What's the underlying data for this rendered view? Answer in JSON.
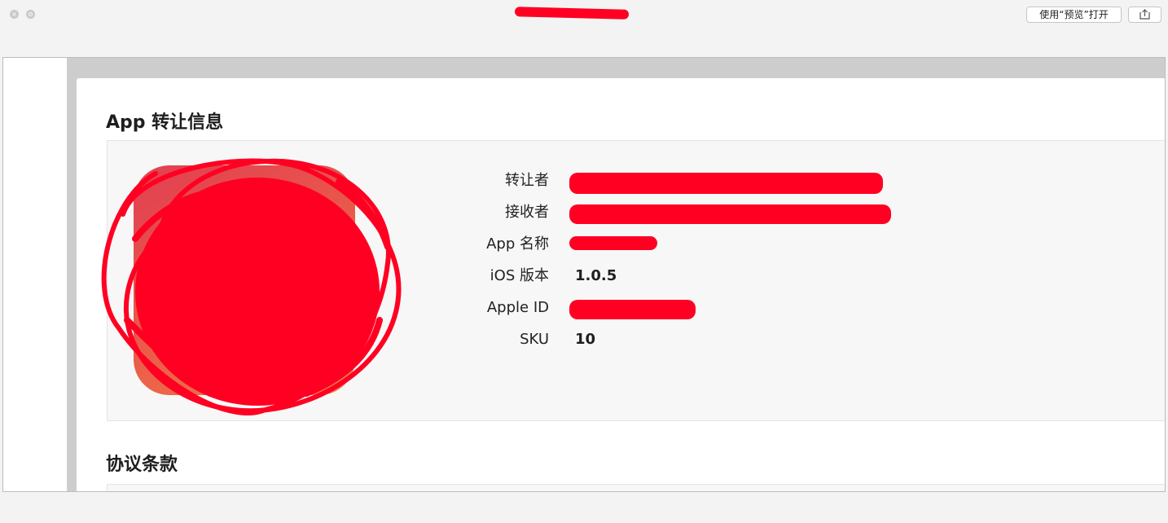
{
  "toolbar": {
    "open_in_preview_label": "使用“预览”打开"
  },
  "icons": {
    "close": "close-icon",
    "minimize": "minimize-icon",
    "share": "share-icon"
  },
  "transfer_section": {
    "title": "App 转让信息",
    "fields": [
      {
        "label": "转让者",
        "value": ""
      },
      {
        "label": "接收者",
        "value": ""
      },
      {
        "label": "App 名称",
        "value": ""
      },
      {
        "label": "iOS 版本",
        "value": "1.0.5"
      },
      {
        "label": "Apple ID",
        "value": ""
      },
      {
        "label": "SKU",
        "value": "10"
      }
    ]
  },
  "agreement_section": {
    "title": "协议条款"
  },
  "colors": {
    "redaction": "#ff0022",
    "icon_gradient_top": "#e23f52",
    "icon_gradient_bottom": "#f07e47"
  }
}
